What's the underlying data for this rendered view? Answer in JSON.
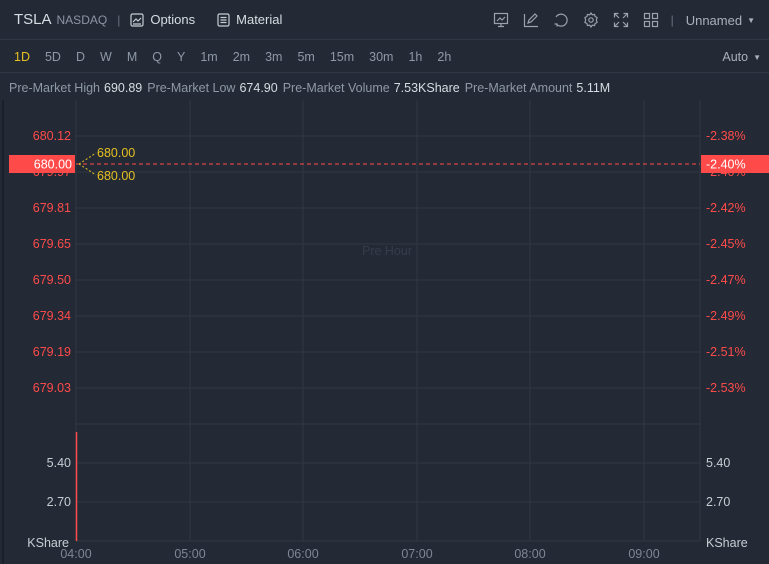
{
  "header": {
    "symbol": "TSLA",
    "exchange": "NASDAQ",
    "separator": "|",
    "options_label": "Options",
    "material_label": "Material",
    "layout_name": "Unnamed"
  },
  "periods": {
    "items": [
      "1D",
      "5D",
      "D",
      "W",
      "M",
      "Q",
      "Y",
      "1m",
      "2m",
      "3m",
      "5m",
      "15m",
      "30m",
      "1h",
      "2h"
    ],
    "active": "1D",
    "scale_label": "Auto"
  },
  "info": [
    {
      "label": "Pre-Market High",
      "value": "690.89"
    },
    {
      "label": "Pre-Market Low",
      "value": "674.90"
    },
    {
      "label": "Pre-Market Volume",
      "value": "7.53KShare"
    },
    {
      "label": "Pre-Market Amount",
      "value": "5.11M"
    }
  ],
  "chart": {
    "watermark": "Pre Hour",
    "price_ticks": [
      "680.12",
      "679.97",
      "679.81",
      "679.65",
      "679.50",
      "679.34",
      "679.19",
      "679.03"
    ],
    "pct_ticks": [
      "-2.38%",
      "-2.40%",
      "-2.42%",
      "-2.45%",
      "-2.47%",
      "-2.49%",
      "-2.51%",
      "-2.53%"
    ],
    "current_price": "680.00",
    "current_pct": "-2.40%",
    "high_label": "680.00",
    "low_label": "680.00",
    "volume_ticks": [
      "5.40",
      "2.70"
    ],
    "volume_unit": "KShare",
    "volume_value": 7.53,
    "volume_max": 8.1,
    "time_ticks": [
      "04:00",
      "05:00",
      "06:00",
      "07:00",
      "08:00",
      "09:00"
    ],
    "colors": {
      "down": "#ff4a4a",
      "highlow": "#e6c020",
      "grid": "#2f3845"
    }
  }
}
